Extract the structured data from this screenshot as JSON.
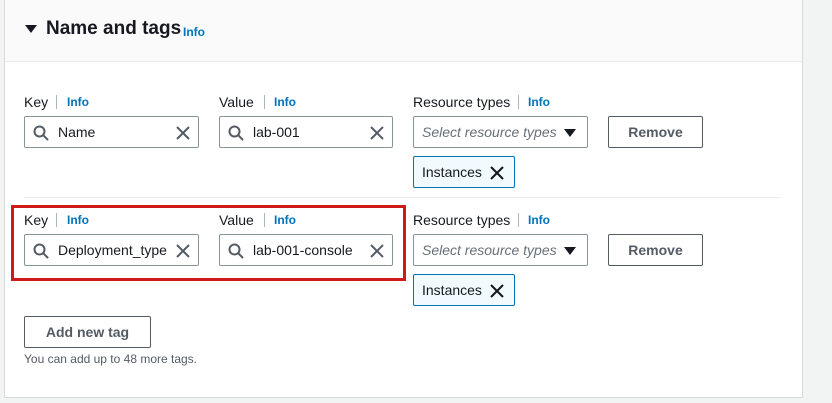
{
  "section": {
    "title": "Name and tags",
    "info": "Info"
  },
  "labels": {
    "key": "Key",
    "value": "Value",
    "resource_types": "Resource types",
    "info": "Info"
  },
  "tags": [
    {
      "key": "Name",
      "value": "lab-001",
      "resource_placeholder": "Select resource types",
      "token": "Instances",
      "remove": "Remove"
    },
    {
      "key": "Deployment_type",
      "value": "lab-001-console",
      "resource_placeholder": "Select resource types",
      "token": "Instances",
      "remove": "Remove"
    }
  ],
  "add_button": "Add new tag",
  "hint": "You can add up to 48 more tags.",
  "colors": {
    "link": "#0073bb",
    "highlight": "#d0191a",
    "border": "#879596"
  },
  "icons": [
    "caret-down-icon",
    "search-icon",
    "clear-icon",
    "dropdown-caret-icon",
    "token-remove-icon"
  ]
}
